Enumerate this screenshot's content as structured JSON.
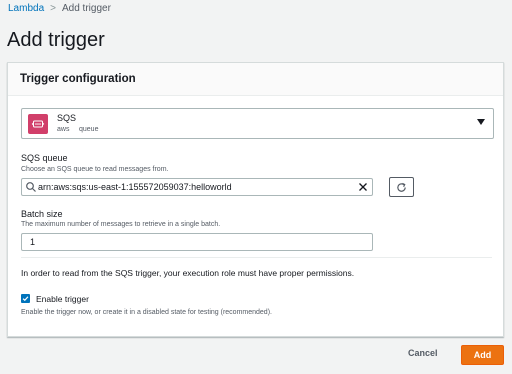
{
  "breadcrumb": {
    "items": [
      "Lambda",
      "Add trigger"
    ],
    "separator": ">"
  },
  "page_title": "Add trigger",
  "panel": {
    "title": "Trigger configuration"
  },
  "trigger_select": {
    "name": "SQS",
    "tags": [
      "aws",
      "queue"
    ],
    "logo_color": "#d13f6a"
  },
  "sqs_queue": {
    "label": "SQS queue",
    "description": "Choose an SQS queue to read messages from.",
    "value": "arn:aws:sqs:us-east-1:155572059037:helloworld"
  },
  "batch_size": {
    "label": "Batch size",
    "description": "The maximum number of messages to retrieve in a single batch.",
    "value": "1"
  },
  "permission_note": "In order to read from the SQS trigger, your execution role must have proper permissions.",
  "enable_trigger": {
    "label": "Enable trigger",
    "checked": true,
    "description": "Enable the trigger now, or create it in a disabled state for testing (recommended)."
  },
  "footer": {
    "cancel_label": "Cancel",
    "add_label": "Add"
  },
  "colors": {
    "link": "#0073bb",
    "primary_button": "#ec7211",
    "checkbox": "#0073bb"
  }
}
